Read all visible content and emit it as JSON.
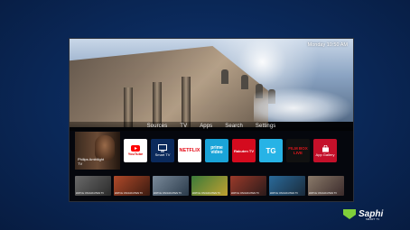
{
  "status": {
    "time": "Monday 10:50 AM"
  },
  "menu": [
    {
      "id": "sources",
      "label": "Sources"
    },
    {
      "id": "tv",
      "label": "TV"
    },
    {
      "id": "apps",
      "label": "Apps"
    },
    {
      "id": "search",
      "label": "Search"
    },
    {
      "id": "settings",
      "label": "Settings"
    }
  ],
  "featured": {
    "label": "Philips Ambilight TV"
  },
  "apps": [
    {
      "id": "youtube",
      "label": "YouTube",
      "bg": "#ffffff",
      "fg": "#d70000"
    },
    {
      "id": "smart-tv",
      "label": "Smart TV",
      "bg": "#0b2a5c",
      "fg": "#ffffff"
    },
    {
      "id": "netflix",
      "label": "NETFLIX",
      "bg": "#ffffff",
      "fg": "#e50914"
    },
    {
      "id": "prime-video",
      "label": "prime video",
      "bg": "#1aa4d8",
      "fg": "#ffffff"
    },
    {
      "id": "rakuten",
      "label": "Rakuten TV",
      "bg": "#d40b1e",
      "fg": "#ffffff"
    },
    {
      "id": "tg",
      "label": "TG",
      "bg": "#27b3e6",
      "fg": "#ffffff"
    },
    {
      "id": "filmbox",
      "label": "FILM BOX LIVE",
      "bg": "#111111",
      "fg": "#e0161c"
    },
    {
      "id": "app-gallery",
      "label": "App Gallery",
      "bg": "#c4102a",
      "fg": "#ffffff"
    }
  ],
  "videos": [
    {
      "caption": "WATCH ON RAKUTEN TV",
      "bg": "linear-gradient(135deg,#6a6a6a,#2a2a2a)"
    },
    {
      "caption": "WATCH ON RAKUTEN TV",
      "bg": "linear-gradient(135deg,#b04a2a,#3a1a10)"
    },
    {
      "caption": "WATCH ON RAKUTEN TV",
      "bg": "linear-gradient(135deg,#7a8a9a,#2a3a4a)"
    },
    {
      "caption": "WATCH ON RAKUTEN TV",
      "bg": "linear-gradient(135deg,#3a7a3a,#c0a030)"
    },
    {
      "caption": "WATCH ON RAKUTEN TV",
      "bg": "linear-gradient(135deg,#9a3a2a,#2a1a1a)"
    },
    {
      "caption": "WATCH ON RAKUTEN TV",
      "bg": "linear-gradient(135deg,#2a6a9a,#1a2a3a)"
    },
    {
      "caption": "WATCH ON RAKUTEN TV",
      "bg": "linear-gradient(135deg,#8a7a6a,#3a2a2a)"
    }
  ],
  "brand": {
    "name": "Saphi",
    "sub": "SMART TV"
  }
}
